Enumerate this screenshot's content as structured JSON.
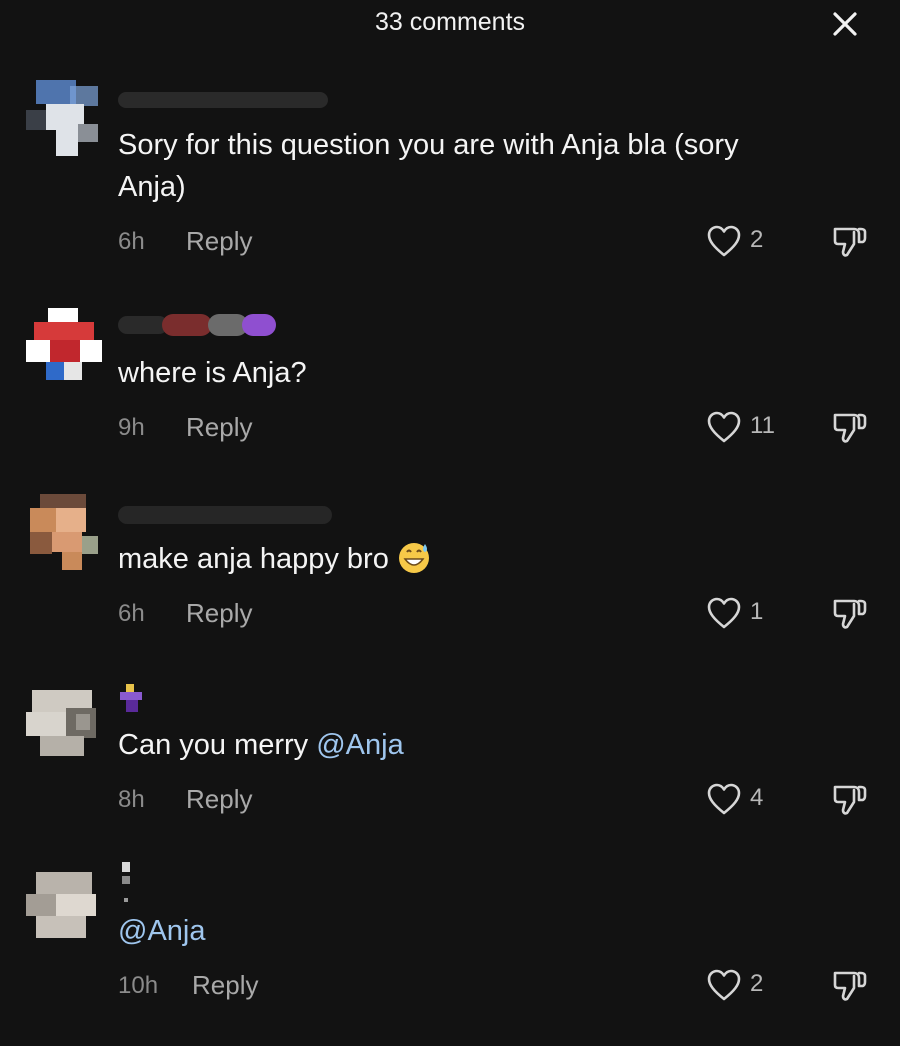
{
  "header": {
    "title": "33 comments",
    "close_icon": "close-icon"
  },
  "comments": [
    {
      "avatar_colors": [
        "#5b86c9",
        "#dfe3e8",
        "#3a3f47"
      ],
      "text": "Sory for this question you are with Anja bla (sory\nAnja)",
      "time": "6h",
      "reply_label": "Reply",
      "likes": "2"
    },
    {
      "avatar_colors": [
        "#d63a3a",
        "#ffffff",
        "#2f6ac9"
      ],
      "text": "where is Anja?",
      "time": "9h",
      "reply_label": "Reply",
      "likes": "11"
    },
    {
      "avatar_colors": [
        "#c98a5a",
        "#e6b08a",
        "#6b4a3a"
      ],
      "text": "make anja happy bro",
      "emoji": "grinning-face-with-sweat",
      "time": "6h",
      "reply_label": "Reply",
      "likes": "1"
    },
    {
      "avatar_colors": [
        "#cfcac2",
        "#9a968f",
        "#6e6a63"
      ],
      "text": "Can you merry ",
      "mention": "@Anja",
      "time": "8h",
      "reply_label": "Reply",
      "likes": "4"
    },
    {
      "avatar_colors": [
        "#b9b3ab",
        "#ded8d0",
        "#8d8780"
      ],
      "text": "",
      "mention": "@Anja",
      "time": "10h",
      "reply_label": "Reply",
      "likes": "2"
    }
  ],
  "icons": {
    "like": "heart-outline-icon",
    "dislike": "thumbs-down-icon"
  },
  "colors": {
    "background": "#121212",
    "mention": "#9fc6ee",
    "muted": "#8b8b8b"
  }
}
